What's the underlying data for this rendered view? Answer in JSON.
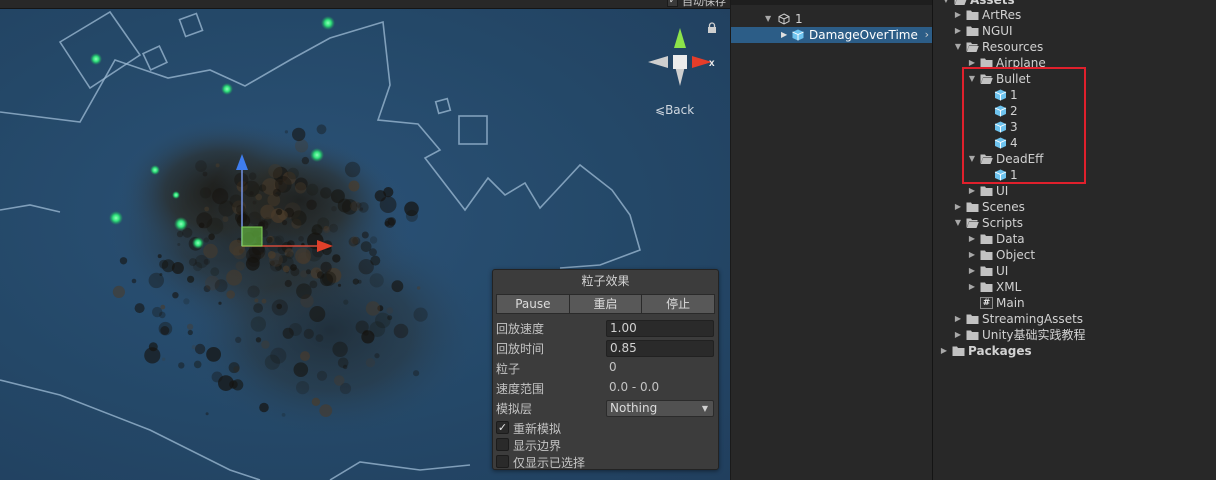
{
  "scene": {
    "autosave_label": "自动保存",
    "back_label": "Back",
    "gizmo_axis_x": "x"
  },
  "particle_panel": {
    "title": "粒子效果",
    "buttons": [
      "Pause",
      "重启",
      "停止"
    ],
    "playback_speed": {
      "label": "回放速度",
      "value": "1.00"
    },
    "playback_time": {
      "label": "回放时间",
      "value": "0.85"
    },
    "particles": {
      "label": "粒子",
      "value": "0"
    },
    "speed_range": {
      "label": "速度范围",
      "value": "0.0 - 0.0"
    },
    "simulation_layers": {
      "label": "模拟层",
      "value": "Nothing"
    },
    "checks": [
      {
        "label": "重新模拟",
        "checked": true
      },
      {
        "label": "显示边界",
        "checked": false
      },
      {
        "label": "仅显示已选择",
        "checked": false
      }
    ]
  },
  "hierarchy": {
    "items": [
      {
        "label": "1"
      },
      {
        "label": "DamageOverTime",
        "selected": true
      }
    ]
  },
  "project": {
    "root_label": "Assets",
    "items": [
      {
        "label": "ArtRes"
      },
      {
        "label": "NGUI"
      },
      {
        "label": "Resources"
      },
      {
        "label": "Airplane"
      },
      {
        "label": "Bullet"
      },
      {
        "label": "1"
      },
      {
        "label": "2"
      },
      {
        "label": "3"
      },
      {
        "label": "4"
      },
      {
        "label": "DeadEff"
      },
      {
        "label": "1"
      },
      {
        "label": "UI"
      },
      {
        "label": "Scenes"
      },
      {
        "label": "Scripts"
      },
      {
        "label": "Data"
      },
      {
        "label": "Object"
      },
      {
        "label": "UI"
      },
      {
        "label": "XML"
      },
      {
        "label": "Main"
      },
      {
        "label": "StreamingAssets"
      },
      {
        "label": "Unity基础实践教程"
      },
      {
        "label": "Packages"
      }
    ]
  },
  "colors": {
    "scene_bg": "#244868",
    "selection": "#2c5d87",
    "highlight_box": "#e0202c",
    "prefab_icon": "#6ec3ee"
  }
}
